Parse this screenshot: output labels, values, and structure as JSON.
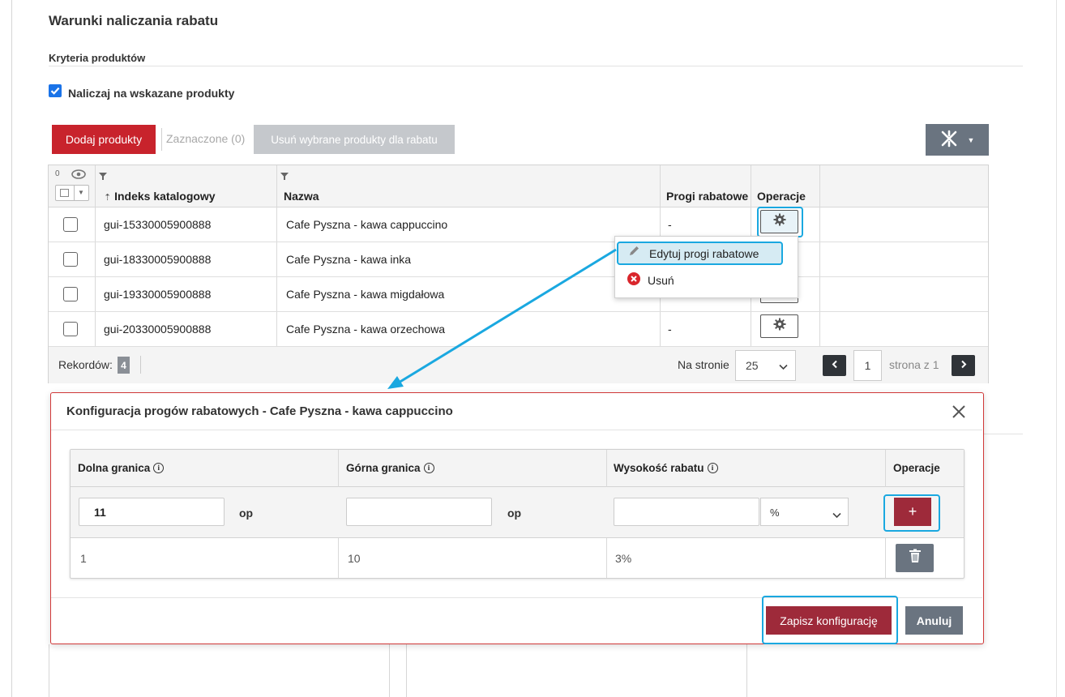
{
  "section": {
    "title": "Warunki naliczania rabatu",
    "subtitle": "Kryteria produktów",
    "checkbox_label": "Naliczaj na wskazane produkty"
  },
  "toolbar": {
    "add_label": "Dodaj produkty",
    "selected_label": "Zaznaczone (0)",
    "remove_label": "Usuń wybrane produkty dla rabatu"
  },
  "table": {
    "visible_count": "0",
    "headers": {
      "index": "Indeks katalogowy",
      "name": "Nazwa",
      "thresholds": "Progi rabatowe",
      "operations": "Operacje"
    },
    "rows": [
      {
        "index": "gui-15330005900888",
        "name": "Cafe Pyszna - kawa cappuccino",
        "thresholds": "-"
      },
      {
        "index": "gui-18330005900888",
        "name": "Cafe Pyszna - kawa inka",
        "thresholds": ""
      },
      {
        "index": "gui-19330005900888",
        "name": "Cafe Pyszna - kawa migdałowa",
        "thresholds": ""
      },
      {
        "index": "gui-20330005900888",
        "name": "Cafe Pyszna - kawa orzechowa",
        "thresholds": "-"
      }
    ],
    "footer": {
      "records_label": "Rekordów:",
      "records_count": "4",
      "per_page_label": "Na stronie",
      "per_page_value": "25",
      "page_value": "1",
      "page_of": "strona z 1"
    }
  },
  "context_menu": {
    "edit_label": "Edytuj progi rabatowe",
    "delete_label": "Usuń"
  },
  "modal": {
    "title": "Konfiguracja progów rabatowych - Cafe Pyszna - kawa cappuccino",
    "headers": {
      "lower": "Dolna granica",
      "upper": "Górna granica",
      "amount": "Wysokość rabatu",
      "operations": "Operacje"
    },
    "form": {
      "lower_value": "11",
      "lower_unit": "op",
      "upper_value": "",
      "upper_unit": "op",
      "amount_value": "",
      "amount_type": "%",
      "add_label": "+"
    },
    "rows": [
      {
        "lower": "1",
        "upper": "10",
        "amount": "3%"
      }
    ],
    "save_label": "Zapisz konfigurację",
    "cancel_label": "Anuluj"
  },
  "colors": {
    "primary_red": "#c8232c",
    "modal_red": "#9e2a3a",
    "highlight": "#1aa8e0",
    "dark_button": "#6a7480"
  }
}
